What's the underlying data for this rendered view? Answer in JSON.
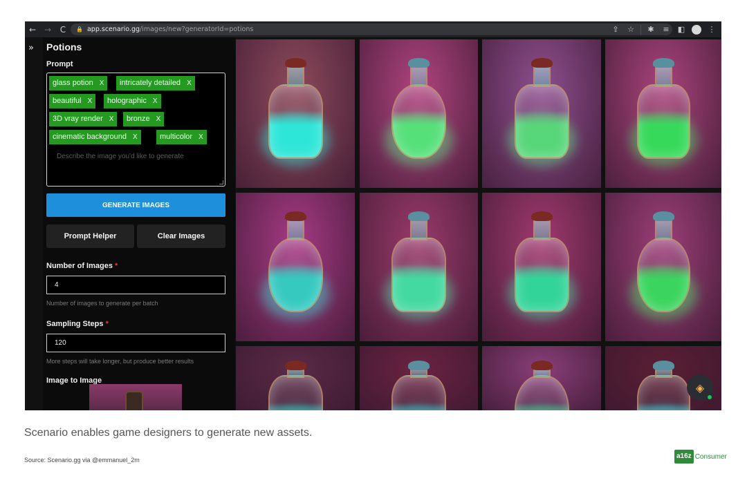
{
  "browser": {
    "back_icon": "←",
    "forward_icon": "→",
    "reload_icon": "C",
    "url_domain": "app.scenario.gg",
    "url_path": "/images/new?generatorId=potions",
    "icons": [
      "share-icon",
      "star-icon",
      "extensions-icon",
      "media-icon",
      "sidebar-icon",
      "profile-icon",
      "menu-icon"
    ]
  },
  "sidebar": {
    "expand_icon": "»"
  },
  "panel": {
    "title": "Potions",
    "prompt_label": "Prompt",
    "tags": [
      {
        "text": "glass potion",
        "remove": "X"
      },
      {
        "text": "intricately detailed",
        "remove": "X"
      },
      {
        "text": "beautiful",
        "remove": "X"
      },
      {
        "text": "holographic",
        "remove": "X"
      },
      {
        "text": "3D vray render",
        "remove": "X"
      },
      {
        "text": "bronze",
        "remove": "X"
      },
      {
        "text": "cinematic background",
        "remove": "X"
      },
      {
        "text": "multicolor",
        "remove": "X"
      }
    ],
    "prompt_placeholder": "Describe the image you'd like to generate",
    "generate_label": "GENERATE IMAGES",
    "prompt_helper_label": "Prompt Helper",
    "clear_images_label": "Clear Images",
    "num_images_label": "Number of Images",
    "num_images_value": "4",
    "num_images_help": "Number of images to generate per batch",
    "steps_label": "Sampling Steps",
    "steps_value": "120",
    "steps_help": "More steps will take longer, but produce better results",
    "required_mark": "*",
    "image_to_image_label": "Image to Image"
  },
  "gallery": {
    "tiles": [
      {
        "bg": "#8e4a5c",
        "liquid": "#2ee6d8",
        "glow": "#34f0e0"
      },
      {
        "bg": "#b0447f",
        "liquid": "#56e07a",
        "glow": "#5cf08a"
      },
      {
        "bg": "#8f4f8f",
        "liquid": "#58d67a",
        "glow": "#64f08a"
      },
      {
        "bg": "#a9447c",
        "liquid": "#37d95a",
        "glow": "#49f06a"
      },
      {
        "bg": "#a63a84",
        "liquid": "#35c9c0",
        "glow": "#3fe8da"
      },
      {
        "bg": "#9a3a6a",
        "liquid": "#43d9a0",
        "glow": "#53f0b8"
      },
      {
        "bg": "#a1396f",
        "liquid": "#33d49a",
        "glow": "#3ff0b0"
      },
      {
        "bg": "#9c3f78",
        "liquid": "#3ad45e",
        "glow": "#52f06e"
      },
      {
        "bg": "#5a2a46",
        "liquid": "#2fc7c0",
        "glow": "#3ad8d0"
      },
      {
        "bg": "#6b2342",
        "liquid": "#33bfc8",
        "glow": "#3ad0d8"
      },
      {
        "bg": "#8a3f7a",
        "liquid": "#3ac88a",
        "glow": "#48d89a"
      },
      {
        "bg": "#5b1f33",
        "liquid": "#37c9d4",
        "glow": "#45dae0"
      }
    ]
  },
  "fab": {
    "icon": "layers-icon"
  },
  "caption": "Scenario enables game designers to generate new assets.",
  "source": "Source: Scenario.gg via @emmanuel_2m",
  "brand": {
    "mark": "a16z",
    "word": "Consumer",
    "color": "#2e8b3a"
  }
}
